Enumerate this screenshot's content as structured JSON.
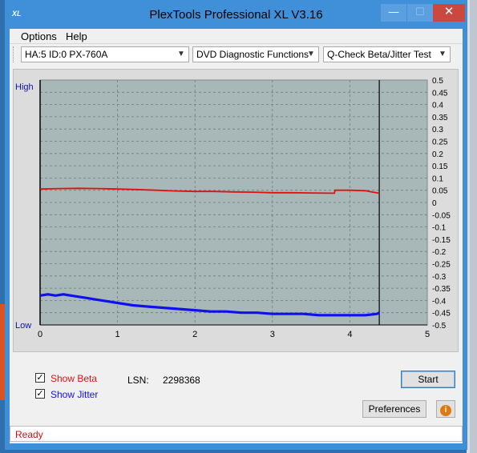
{
  "window": {
    "title": "PlexTools Professional XL V3.16",
    "app_icon_text": "XL",
    "minimize_glyph": "—",
    "maximize_glyph": "☐",
    "close_glyph": "✕"
  },
  "menu": {
    "items": [
      {
        "label": "Options"
      },
      {
        "label": "Help"
      }
    ]
  },
  "toolbar": {
    "drive_select": "HA:5 ID:0  PX-760A",
    "function_select": "DVD Diagnostic Functions",
    "test_select": "Q-Check Beta/Jitter Test"
  },
  "chart_data": {
    "type": "line",
    "background": "#a8b8b8",
    "grid": true,
    "left_axis_labels": {
      "top": "High",
      "bottom": "Low"
    },
    "xlim": [
      0,
      5
    ],
    "x_ticks": [
      "0",
      "1",
      "2",
      "3",
      "4",
      "5"
    ],
    "ylim": [
      -0.5,
      0.5
    ],
    "y_ticks": [
      "0.5",
      "0.45",
      "0.4",
      "0.35",
      "0.3",
      "0.25",
      "0.2",
      "0.15",
      "0.1",
      "0.05",
      "0",
      "-0.05",
      "-0.1",
      "-0.15",
      "-0.2",
      "-0.25",
      "-0.3",
      "-0.35",
      "-0.4",
      "-0.45",
      "-0.5"
    ],
    "end_marker_x": 4.38,
    "series": [
      {
        "key": "beta",
        "color": "#e01010",
        "x": [
          0,
          0.25,
          0.5,
          0.75,
          1.0,
          1.25,
          1.5,
          1.75,
          2.0,
          2.25,
          2.5,
          2.75,
          3.0,
          3.25,
          3.5,
          3.75,
          3.8,
          3.81,
          4.0,
          4.2,
          4.3,
          4.38
        ],
        "values": [
          0.055,
          0.057,
          0.058,
          0.057,
          0.055,
          0.053,
          0.05,
          0.047,
          0.045,
          0.045,
          0.043,
          0.042,
          0.04,
          0.04,
          0.039,
          0.038,
          0.038,
          0.05,
          0.05,
          0.048,
          0.042,
          0.038
        ]
      },
      {
        "key": "jitter",
        "color": "#1010ee",
        "x": [
          0,
          0.1,
          0.2,
          0.3,
          0.4,
          0.5,
          0.6,
          0.7,
          0.8,
          0.9,
          1.0,
          1.2,
          1.4,
          1.6,
          1.8,
          2.0,
          2.2,
          2.4,
          2.6,
          2.8,
          3.0,
          3.2,
          3.4,
          3.6,
          3.8,
          4.0,
          4.2,
          4.35,
          4.38
        ],
        "values": [
          -0.38,
          -0.375,
          -0.38,
          -0.375,
          -0.38,
          -0.385,
          -0.39,
          -0.395,
          -0.4,
          -0.405,
          -0.41,
          -0.42,
          -0.425,
          -0.43,
          -0.435,
          -0.44,
          -0.445,
          -0.445,
          -0.45,
          -0.45,
          -0.455,
          -0.455,
          -0.455,
          -0.46,
          -0.46,
          -0.46,
          -0.46,
          -0.455,
          -0.45
        ]
      }
    ]
  },
  "controls": {
    "show_beta_label": "Show Beta",
    "show_beta_checked": true,
    "show_jitter_label": "Show Jitter",
    "show_jitter_checked": true,
    "lsn_label": "LSN:",
    "lsn_value": "2298368",
    "start_button": "Start",
    "preferences_button": "Preferences",
    "info_glyph": "i",
    "check_glyph": "✓"
  },
  "status": {
    "text": "Ready"
  }
}
